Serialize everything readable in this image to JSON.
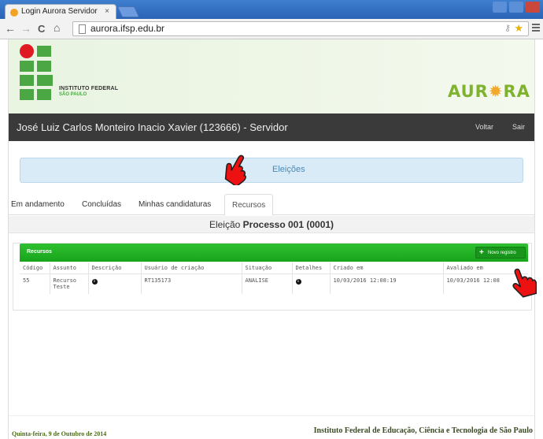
{
  "browser": {
    "tab_title": "Login Aurora Servidor",
    "tab_close": "×",
    "url": "aurora.ifsp.edu.br",
    "back": "←",
    "forward": "→",
    "reload": "C",
    "home": "⌂"
  },
  "banner": {
    "institute_line1": "INSTITUTO FEDERAL",
    "institute_line2": "SÃO PAULO",
    "brand_left": "AUR",
    "brand_sun": "✹",
    "brand_right": "RA",
    "logo_green": "#4ba744",
    "logo_red": "#e01a22"
  },
  "user_bar": {
    "user": "José Luiz Carlos Monteiro Inacio Xavier (123666) - Servidor",
    "voltar": "Voltar",
    "sair": "Sair"
  },
  "main": {
    "section_title": "Eleições",
    "tabs": [
      "Em andamento",
      "Concluídas",
      "Minhas candidaturas",
      "Recursos"
    ],
    "active_tab": "Recursos",
    "election_prefix": "Eleição",
    "election_name": "Processo 001 (0001)"
  },
  "panel": {
    "title": "Recursos",
    "new_button": "Novo registro",
    "accent": "#1ca820",
    "columns": [
      "Código",
      "Assunto",
      "Descrição",
      "Usuário de criação",
      "Situação",
      "Detalhes",
      "Criado em",
      "Avaliado em"
    ],
    "rows": [
      {
        "codigo": "55",
        "assunto": "Recurso Teste",
        "descricao_icon": "info-icon",
        "usuario": "RT135173",
        "situacao": "ANALISE",
        "detalhes_icon": "info-icon",
        "criado": "10/03/2016 12:08:19",
        "avaliado": "10/03/2016 12:08"
      }
    ]
  },
  "footer": {
    "date": "Quinta-feira, 9 de Outubro de 2014",
    "institution": "Instituto Federal de Educação, Ciência e Tecnologia de São Paulo"
  }
}
